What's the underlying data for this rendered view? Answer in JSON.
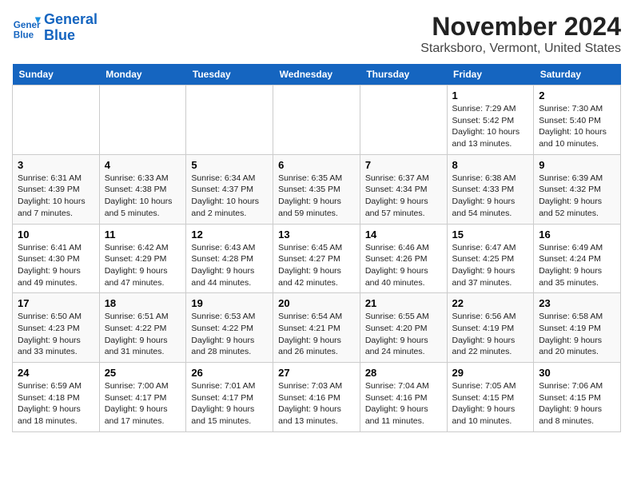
{
  "header": {
    "logo_line1": "General",
    "logo_line2": "Blue",
    "month": "November 2024",
    "location": "Starksboro, Vermont, United States"
  },
  "days_of_week": [
    "Sunday",
    "Monday",
    "Tuesday",
    "Wednesday",
    "Thursday",
    "Friday",
    "Saturday"
  ],
  "weeks": [
    [
      {
        "day": "",
        "info": ""
      },
      {
        "day": "",
        "info": ""
      },
      {
        "day": "",
        "info": ""
      },
      {
        "day": "",
        "info": ""
      },
      {
        "day": "",
        "info": ""
      },
      {
        "day": "1",
        "info": "Sunrise: 7:29 AM\nSunset: 5:42 PM\nDaylight: 10 hours and 13 minutes."
      },
      {
        "day": "2",
        "info": "Sunrise: 7:30 AM\nSunset: 5:40 PM\nDaylight: 10 hours and 10 minutes."
      }
    ],
    [
      {
        "day": "3",
        "info": "Sunrise: 6:31 AM\nSunset: 4:39 PM\nDaylight: 10 hours and 7 minutes."
      },
      {
        "day": "4",
        "info": "Sunrise: 6:33 AM\nSunset: 4:38 PM\nDaylight: 10 hours and 5 minutes."
      },
      {
        "day": "5",
        "info": "Sunrise: 6:34 AM\nSunset: 4:37 PM\nDaylight: 10 hours and 2 minutes."
      },
      {
        "day": "6",
        "info": "Sunrise: 6:35 AM\nSunset: 4:35 PM\nDaylight: 9 hours and 59 minutes."
      },
      {
        "day": "7",
        "info": "Sunrise: 6:37 AM\nSunset: 4:34 PM\nDaylight: 9 hours and 57 minutes."
      },
      {
        "day": "8",
        "info": "Sunrise: 6:38 AM\nSunset: 4:33 PM\nDaylight: 9 hours and 54 minutes."
      },
      {
        "day": "9",
        "info": "Sunrise: 6:39 AM\nSunset: 4:32 PM\nDaylight: 9 hours and 52 minutes."
      }
    ],
    [
      {
        "day": "10",
        "info": "Sunrise: 6:41 AM\nSunset: 4:30 PM\nDaylight: 9 hours and 49 minutes."
      },
      {
        "day": "11",
        "info": "Sunrise: 6:42 AM\nSunset: 4:29 PM\nDaylight: 9 hours and 47 minutes."
      },
      {
        "day": "12",
        "info": "Sunrise: 6:43 AM\nSunset: 4:28 PM\nDaylight: 9 hours and 44 minutes."
      },
      {
        "day": "13",
        "info": "Sunrise: 6:45 AM\nSunset: 4:27 PM\nDaylight: 9 hours and 42 minutes."
      },
      {
        "day": "14",
        "info": "Sunrise: 6:46 AM\nSunset: 4:26 PM\nDaylight: 9 hours and 40 minutes."
      },
      {
        "day": "15",
        "info": "Sunrise: 6:47 AM\nSunset: 4:25 PM\nDaylight: 9 hours and 37 minutes."
      },
      {
        "day": "16",
        "info": "Sunrise: 6:49 AM\nSunset: 4:24 PM\nDaylight: 9 hours and 35 minutes."
      }
    ],
    [
      {
        "day": "17",
        "info": "Sunrise: 6:50 AM\nSunset: 4:23 PM\nDaylight: 9 hours and 33 minutes."
      },
      {
        "day": "18",
        "info": "Sunrise: 6:51 AM\nSunset: 4:22 PM\nDaylight: 9 hours and 31 minutes."
      },
      {
        "day": "19",
        "info": "Sunrise: 6:53 AM\nSunset: 4:22 PM\nDaylight: 9 hours and 28 minutes."
      },
      {
        "day": "20",
        "info": "Sunrise: 6:54 AM\nSunset: 4:21 PM\nDaylight: 9 hours and 26 minutes."
      },
      {
        "day": "21",
        "info": "Sunrise: 6:55 AM\nSunset: 4:20 PM\nDaylight: 9 hours and 24 minutes."
      },
      {
        "day": "22",
        "info": "Sunrise: 6:56 AM\nSunset: 4:19 PM\nDaylight: 9 hours and 22 minutes."
      },
      {
        "day": "23",
        "info": "Sunrise: 6:58 AM\nSunset: 4:19 PM\nDaylight: 9 hours and 20 minutes."
      }
    ],
    [
      {
        "day": "24",
        "info": "Sunrise: 6:59 AM\nSunset: 4:18 PM\nDaylight: 9 hours and 18 minutes."
      },
      {
        "day": "25",
        "info": "Sunrise: 7:00 AM\nSunset: 4:17 PM\nDaylight: 9 hours and 17 minutes."
      },
      {
        "day": "26",
        "info": "Sunrise: 7:01 AM\nSunset: 4:17 PM\nDaylight: 9 hours and 15 minutes."
      },
      {
        "day": "27",
        "info": "Sunrise: 7:03 AM\nSunset: 4:16 PM\nDaylight: 9 hours and 13 minutes."
      },
      {
        "day": "28",
        "info": "Sunrise: 7:04 AM\nSunset: 4:16 PM\nDaylight: 9 hours and 11 minutes."
      },
      {
        "day": "29",
        "info": "Sunrise: 7:05 AM\nSunset: 4:15 PM\nDaylight: 9 hours and 10 minutes."
      },
      {
        "day": "30",
        "info": "Sunrise: 7:06 AM\nSunset: 4:15 PM\nDaylight: 9 hours and 8 minutes."
      }
    ]
  ]
}
